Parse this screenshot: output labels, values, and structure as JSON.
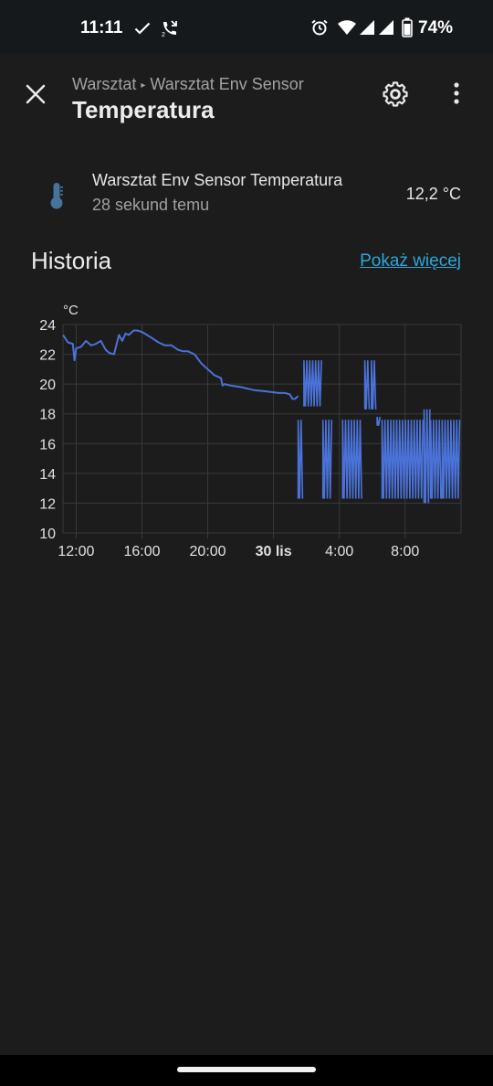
{
  "status_bar": {
    "time": "11:11",
    "battery": "74%",
    "icons": [
      "check-icon",
      "call-forward-icon",
      "alarm-icon",
      "wifi-icon",
      "signal-icon",
      "signal-icon",
      "battery-icon"
    ]
  },
  "header": {
    "breadcrumb_parent": "Warsztat",
    "breadcrumb_separator": "▸",
    "breadcrumb_device": "Warsztat Env Sensor",
    "title": "Temperatura",
    "icons": [
      "close-icon",
      "gear-icon",
      "more-vertical-icon"
    ]
  },
  "entity": {
    "name": "Warsztat Env Sensor Temperatura",
    "last_changed": "28 sekund temu",
    "value": "12,2 °C",
    "icon": "thermometer-icon",
    "icon_color": "#44739e"
  },
  "history": {
    "title": "Historia",
    "more_link": "Pokaż więcej"
  },
  "chart_data": {
    "type": "line",
    "ylabel": "°C",
    "ylim": [
      10,
      24
    ],
    "yticks": [
      "10",
      "12",
      "14",
      "16",
      "18",
      "20",
      "22",
      "24"
    ],
    "xticks": [
      "12:00",
      "16:00",
      "20:00",
      "30 lis",
      "4:00",
      "8:00"
    ],
    "xtick_hours": [
      12,
      16,
      20,
      24,
      28,
      32
    ],
    "xlim_hours": [
      11.2,
      35.4
    ],
    "grid": true,
    "line_color": "#4a72d8",
    "series": [
      {
        "x": [
          11.2,
          11.5,
          11.8,
          11.9,
          12.0,
          12.3,
          12.6,
          12.9,
          13.2,
          13.5,
          13.8,
          14.0,
          14.3,
          14.6,
          14.8,
          15.0,
          15.2,
          15.5,
          15.7,
          16.0,
          16.3,
          16.6,
          17.0,
          17.4,
          17.8,
          18.2,
          18.5,
          18.8,
          19.2,
          19.6,
          20.0,
          20.4,
          20.8,
          20.9,
          21.0,
          21.4,
          22.0,
          22.8,
          23.6,
          24.3,
          24.7,
          25.0,
          25.15,
          25.3,
          25.5
        ],
        "y": [
          23.3,
          22.8,
          22.7,
          21.6,
          22.4,
          22.5,
          22.9,
          22.6,
          22.7,
          22.9,
          22.3,
          22.1,
          22.0,
          23.3,
          22.9,
          23.4,
          23.3,
          23.6,
          23.6,
          23.5,
          23.3,
          23.1,
          22.8,
          22.6,
          22.6,
          22.3,
          22.2,
          22.2,
          22.0,
          21.4,
          21.0,
          20.6,
          20.4,
          19.9,
          20.0,
          19.9,
          19.8,
          19.6,
          19.5,
          19.4,
          19.4,
          19.3,
          19.0,
          19.0,
          19.2
        ]
      }
    ],
    "oscillation_bands": [
      {
        "from": 25.5,
        "to": 25.85,
        "low": 12.3,
        "high": 17.6
      },
      {
        "from": 25.85,
        "to": 27.0,
        "low": 18.5,
        "high": 21.6
      },
      {
        "from": 27.0,
        "to": 27.6,
        "low": 12.3,
        "high": 17.6
      },
      {
        "from": 28.2,
        "to": 29.4,
        "low": 12.3,
        "high": 17.6
      },
      {
        "from": 29.55,
        "to": 29.85,
        "low": 18.3,
        "high": 21.6
      },
      {
        "from": 29.95,
        "to": 30.3,
        "low": 18.3,
        "high": 21.6
      },
      {
        "from": 30.3,
        "to": 30.55,
        "low": 17.2,
        "high": 17.8
      },
      {
        "from": 30.6,
        "to": 33.15,
        "low": 12.3,
        "high": 17.6
      },
      {
        "from": 33.15,
        "to": 33.55,
        "low": 12.0,
        "high": 18.3
      },
      {
        "from": 33.55,
        "to": 34.25,
        "low": 12.3,
        "high": 17.6
      },
      {
        "from": 34.25,
        "to": 35.4,
        "low": 12.3,
        "high": 17.6
      }
    ]
  },
  "colors": {
    "background": "#1c1c1c",
    "status_bar": "#15191b",
    "accent_link": "#2aa7d8",
    "chart_line": "#4a72d8"
  }
}
